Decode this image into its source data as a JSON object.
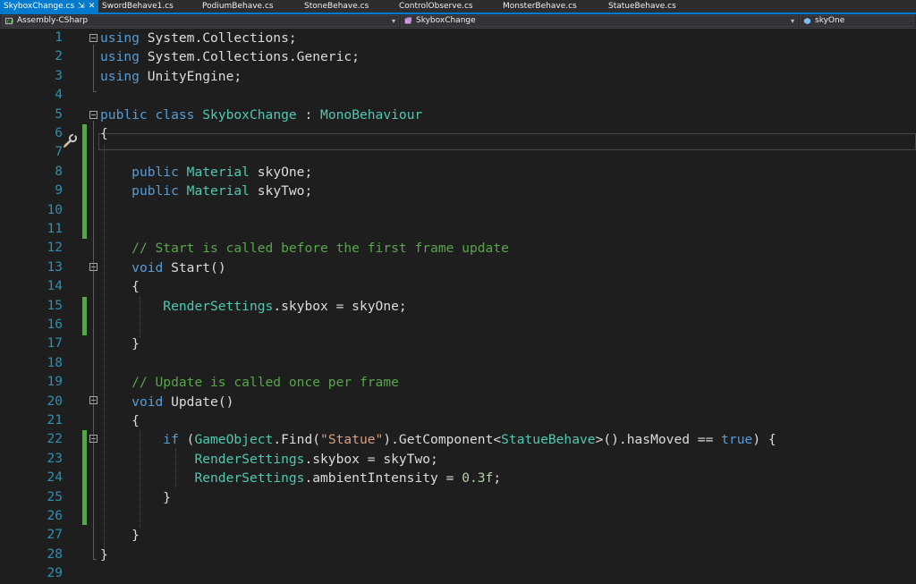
{
  "tabs": [
    {
      "label": "SkyboxChange.cs",
      "active": true,
      "pin": "⇲",
      "close": "✕"
    },
    {
      "label": "SwordBehave1.cs"
    },
    {
      "label": "PodiumBehave.cs"
    },
    {
      "label": "StoneBehave.cs"
    },
    {
      "label": "ControlObserve.cs"
    },
    {
      "label": "MonsterBehave.cs"
    },
    {
      "label": "StatueBehave.cs"
    }
  ],
  "navbar": {
    "project": "Assembly-CSharp",
    "class": "SkyboxChange",
    "member": "skyOne"
  },
  "code_lines": [
    "using System.Collections;",
    "using System.Collections.Generic;",
    "using UnityEngine;",
    "",
    "public class SkyboxChange : MonoBehaviour",
    "{",
    "",
    "    public Material skyOne;",
    "    public Material skyTwo;",
    "",
    "",
    "    // Start is called before the first frame update",
    "    void Start()",
    "    {",
    "        RenderSettings.skybox = skyOne;",
    "",
    "    }",
    "",
    "    // Update is called once per frame",
    "    void Update()",
    "    {",
    "        if (GameObject.Find(\"Statue\").GetComponent<StatueBehave>().hasMoved == true) {",
    "            RenderSettings.skybox = skyTwo;",
    "            RenderSettings.ambientIntensity = 0.3f;",
    "        }",
    "",
    "    }",
    "}",
    ""
  ],
  "colors": {
    "keyword": "#569cd6",
    "type": "#4ec9b0",
    "comment": "#57a64a",
    "string": "#d69d85",
    "number": "#b5cea8",
    "line_number": "#2b91af",
    "tab_active": "#007acc",
    "background": "#1e1e1e"
  },
  "icons": {
    "quick_action": "screwdriver-wrench-icon",
    "project": "csharp-project-icon",
    "class": "class-icon",
    "member": "field-icon"
  }
}
